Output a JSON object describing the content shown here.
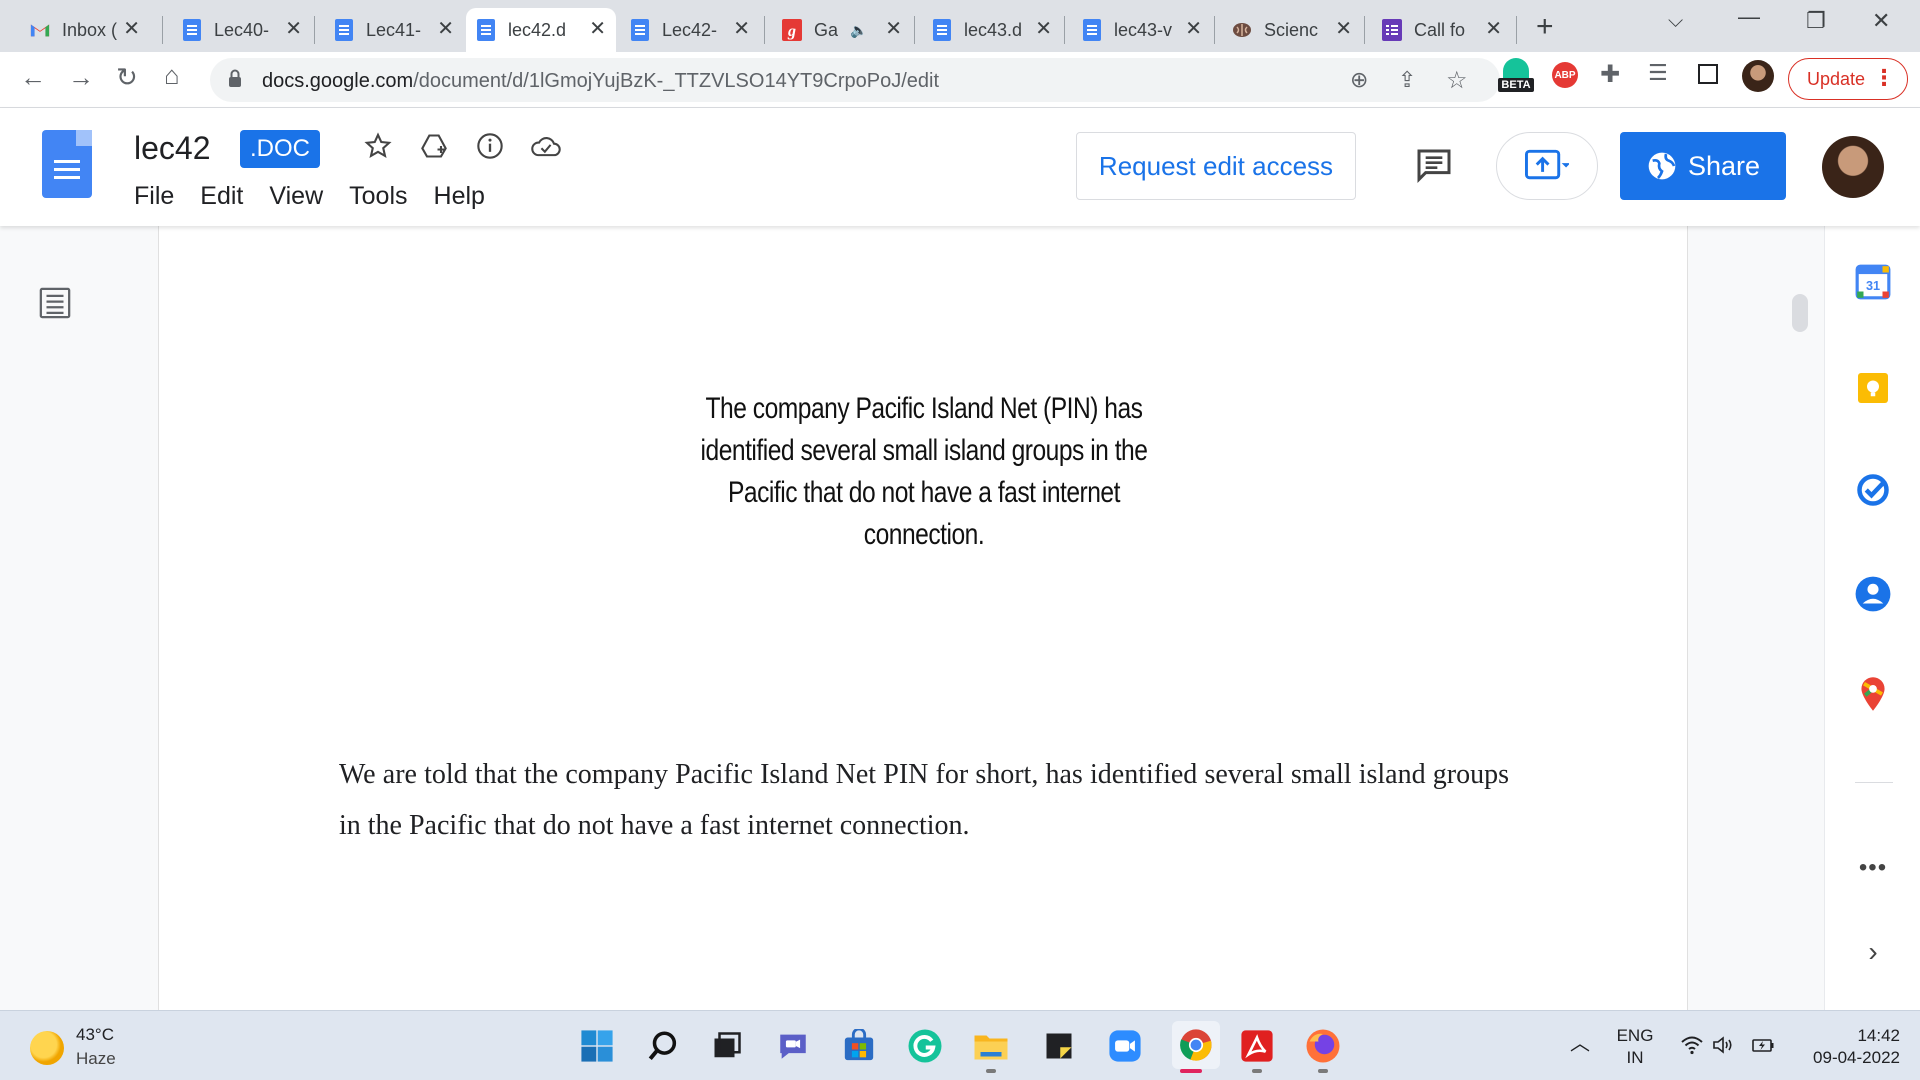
{
  "browser": {
    "tabs": [
      {
        "title": "Inbox (",
        "icon": "gmail-icon"
      },
      {
        "title": "Lec40-",
        "icon": "docs-icon"
      },
      {
        "title": "Lec41-",
        "icon": "docs-icon"
      },
      {
        "title": "lec42.d",
        "icon": "docs-icon",
        "active": true
      },
      {
        "title": "Lec42-",
        "icon": "docs-icon"
      },
      {
        "title": "Ga",
        "icon": "g-icon",
        "audio": true
      },
      {
        "title": "lec43.d",
        "icon": "docs-icon"
      },
      {
        "title": "lec43-v",
        "icon": "docs-icon"
      },
      {
        "title": "Scienc",
        "icon": "brain-icon"
      },
      {
        "title": "Call fo",
        "icon": "forms-icon"
      }
    ],
    "url_host": "docs.google.com",
    "url_path": "/document/d/1lGmojYujBzK-_TTZVLSO14YT9CrpoPoJ/edit",
    "beta_label": "BETA",
    "abp_label": "ABP",
    "update_label": "Update"
  },
  "docs": {
    "title": "lec42",
    "badge": ".DOC",
    "menu": [
      "File",
      "Edit",
      "View",
      "Tools",
      "Help"
    ],
    "request_edit_label": "Request edit access",
    "share_label": "Share"
  },
  "document": {
    "slide_text": "The company Pacific Island Net (PIN) has identified several small island groups in the Pacific that do not have a fast internet connection.",
    "body_text": "We are told that the company Pacific Island Net PIN for short, has identified several small island groups in the Pacific that do not have a fast internet connection."
  },
  "side_panel": {
    "calendar_day": "31"
  },
  "taskbar": {
    "temperature": "43°C",
    "weather": "Haze",
    "lang_top": "ENG",
    "lang_bottom": "IN",
    "time": "14:42",
    "date": "09-04-2022"
  },
  "colors": {
    "accent": "#1a73e8",
    "docs_blue": "#4285f4",
    "update_red": "#d93025"
  }
}
